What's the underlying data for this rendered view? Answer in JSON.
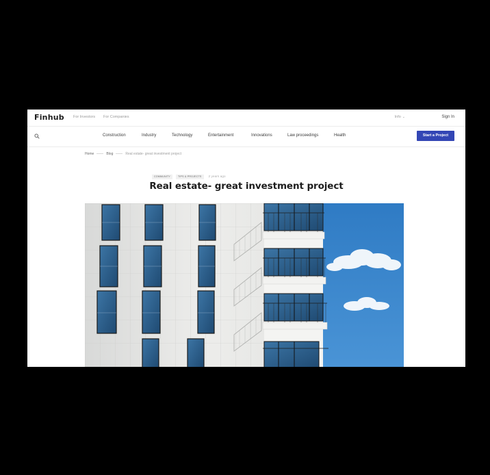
{
  "header": {
    "logo": "Finhub",
    "links": [
      "For Investors",
      "For Companies"
    ],
    "language": "Info",
    "sign_in": "Sign In"
  },
  "categories": [
    "Construction",
    "Industry",
    "Technology",
    "Entertainment",
    "Innovations",
    "Law proceedings",
    "Health"
  ],
  "cta_label": "Start a Project",
  "breadcrumb": {
    "home": "Home",
    "blog": "Blog",
    "current": "Real estate- great investment project"
  },
  "article": {
    "tags": [
      "COMMUNITY",
      "TIPS & PROJECTS"
    ],
    "time": "2 years ago",
    "title": "Real estate- great investment project"
  },
  "colors": {
    "accent": "#3346b5",
    "sky": "#3d84c9",
    "facade": "#e9e9e6",
    "window": "#2f5f89"
  },
  "icons": [
    "search-icon",
    "chevron-down-icon"
  ]
}
